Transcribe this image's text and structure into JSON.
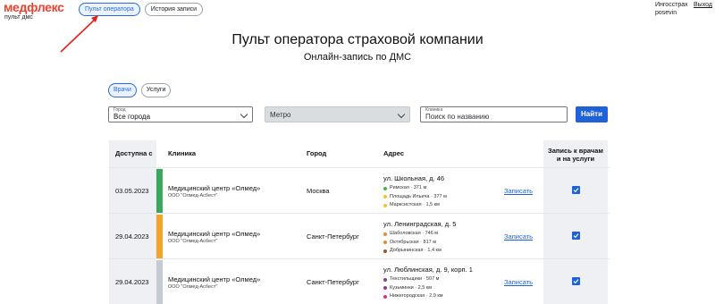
{
  "brand": {
    "logo": "медфлекс",
    "tagline": "пульт дмс"
  },
  "topnav": {
    "tabs": [
      {
        "label": "Пульт оператора"
      },
      {
        "label": "История записи"
      }
    ]
  },
  "user": {
    "company": "Ингосстрах",
    "login": "posevin",
    "logout": "Выход"
  },
  "page": {
    "title": "Пульт оператора страховой компании",
    "subtitle": "Онлайн-запись по ДМС"
  },
  "filters": {
    "tabs": [
      {
        "label": "Врачи"
      },
      {
        "label": "Услуги"
      }
    ],
    "city": {
      "label": "Город",
      "value": "Все города"
    },
    "metro": {
      "value": "Метро"
    },
    "clinic": {
      "label": "Клиника",
      "placeholder": "Поиск по названию"
    },
    "find_button": "Найти"
  },
  "table": {
    "headers": {
      "date": "Доступна с",
      "clinic": "Клиника",
      "city": "Город",
      "address": "Адрес",
      "book": "Запись к врачам и на услуги"
    },
    "rows": [
      {
        "date": "03.05.2023",
        "stripe_color": "#3aa95c",
        "clinic": "Медицинский центр «Олмед»",
        "org": "ООО \"Олмед-Асбест\"",
        "city": "Москва",
        "address": "ул. Школьная, д. 46",
        "metros": [
          {
            "name": "Римская",
            "dist": "371 м",
            "color": "#43b649"
          },
          {
            "name": "Площадь Ильича",
            "dist": "377 м",
            "color": "#f7c51c"
          },
          {
            "name": "Марксистская",
            "dist": "1,5 км",
            "color": "#f7c51c"
          }
        ],
        "book": "Записать",
        "checked": true
      },
      {
        "date": "29.04.2023",
        "stripe_color": "#f5a32b",
        "clinic": "Медицинский центр «Олмед»",
        "org": "ООО \"Олмед-Асбест\"",
        "city": "Санкт-Петербург",
        "address": "ул. Ленинградская, д. 5",
        "metros": [
          {
            "name": "Шаболовская",
            "dist": "746 м",
            "color": "#f08a2a"
          },
          {
            "name": "Октябрьская",
            "dist": "817 м",
            "color": "#f08a2a"
          },
          {
            "name": "Добрынинская",
            "dist": "1,4 км",
            "color": "#a0522d"
          }
        ],
        "book": "Записать",
        "checked": true
      },
      {
        "date": "29.04.2023",
        "stripe_color": "#c5cbd3",
        "clinic": "Медицинский центр «Олмед»",
        "org": "ООО \"Олмед-Асбест\"",
        "city": "Санкт-Петербург",
        "address": "ул. Люблинская, д. 9, корп. 1",
        "metros": [
          {
            "name": "Текстильщики",
            "dist": "507 м",
            "color": "#8e3a97"
          },
          {
            "name": "Кузьминки",
            "dist": "2,5 км",
            "color": "#8e3a97"
          },
          {
            "name": "Нижегородская",
            "dist": "2,9 км",
            "color": "#e6307a"
          }
        ],
        "book": "Записать",
        "checked": true
      }
    ]
  }
}
